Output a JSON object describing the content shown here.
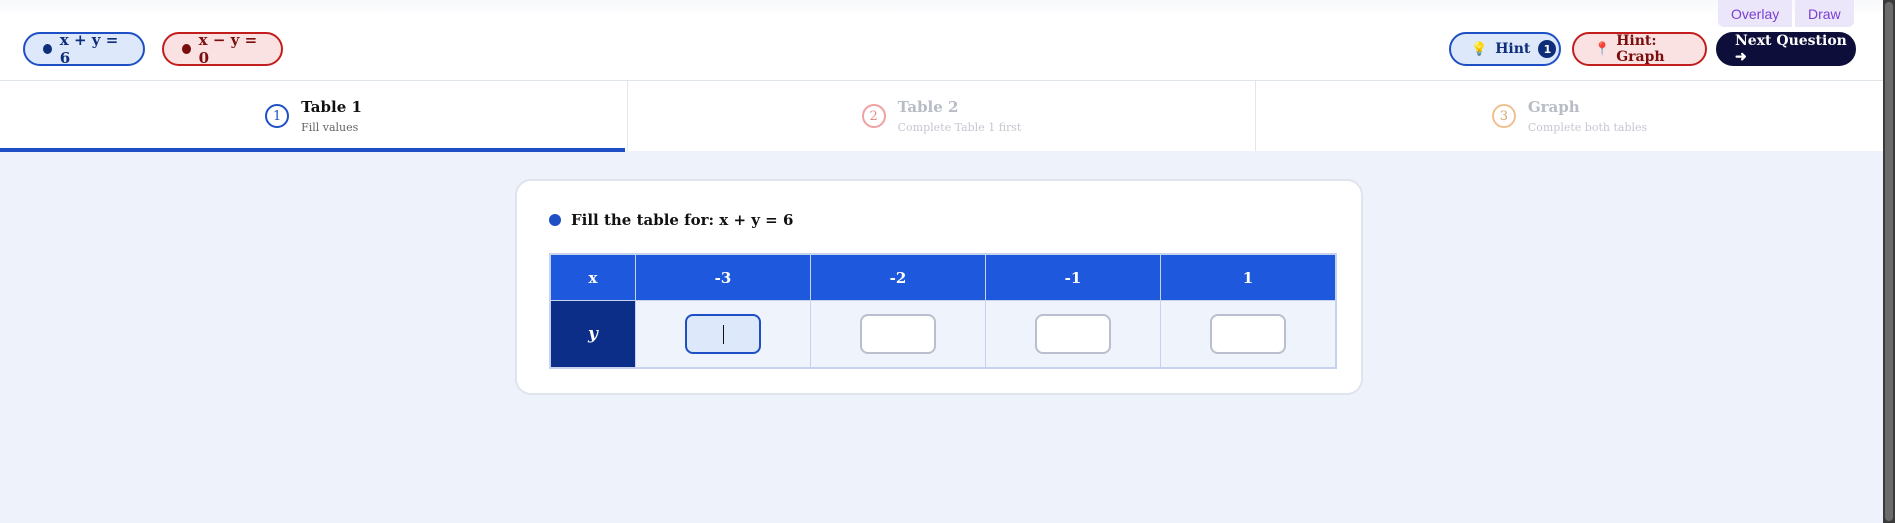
{
  "overlay": {
    "overlay_label": "Overlay",
    "draw_label": "Draw"
  },
  "equations": [
    {
      "label": "x + y = 6",
      "color": "#0f2e7a"
    },
    {
      "label": "x − y = 0",
      "color": "#7a0d0d"
    }
  ],
  "toolbar": {
    "hint_label": "Hint",
    "hint_count": "1",
    "hint_graph_label": "Hint: Graph",
    "next_label": "Next Question ➜"
  },
  "steps": [
    {
      "num": "1",
      "title": "Table 1",
      "subtitle": "Fill values",
      "state": "active"
    },
    {
      "num": "2",
      "title": "Table 2",
      "subtitle": "Complete Table 1 first",
      "state": "locked"
    },
    {
      "num": "3",
      "title": "Graph",
      "subtitle": "Complete both tables",
      "state": "locked"
    }
  ],
  "card": {
    "title": "Fill the table for: x + y = 6",
    "row_x_label": "x",
    "row_y_label": "y",
    "x_values": [
      "-3",
      "-2",
      "-1",
      "1"
    ],
    "y_values": [
      "",
      "",
      "",
      ""
    ],
    "focused_index": 0
  },
  "colors": {
    "accent": "#1e58dc",
    "danger": "#c21e1e",
    "dark": "#0e0e3a"
  }
}
